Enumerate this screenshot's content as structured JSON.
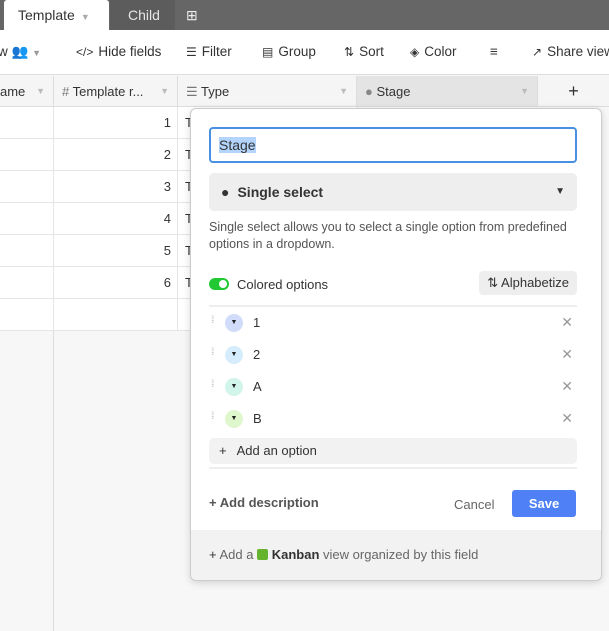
{
  "tabs": {
    "active": "Template",
    "child": "Child",
    "add_icon": "plus-square-icon"
  },
  "toolbar": {
    "view_partial": "w",
    "hide_fields": "Hide fields",
    "filter": "Filter",
    "group": "Group",
    "sort": "Sort",
    "color": "Color",
    "share": "Share view"
  },
  "columns": [
    "ame",
    "Template r...",
    "Type",
    "Stage"
  ],
  "rows": [
    {
      "num": "1",
      "type": "T"
    },
    {
      "num": "2",
      "type": "T"
    },
    {
      "num": "3",
      "type": "T"
    },
    {
      "num": "4",
      "type": "T"
    },
    {
      "num": "5",
      "type": "T"
    },
    {
      "num": "6",
      "type": "T"
    }
  ],
  "popup": {
    "field_name": "Stage",
    "field_type": "Single select",
    "description": "Single select allows you to select a single option from predefined options in a dropdown.",
    "colored_options_label": "Colored options",
    "colored_options_on": true,
    "alphabetize": "Alphabetize",
    "options": [
      {
        "label": "1",
        "color": "#d0dcfa"
      },
      {
        "label": "2",
        "color": "#d4ecfc"
      },
      {
        "label": "A",
        "color": "#d1f5ea"
      },
      {
        "label": "B",
        "color": "#dff7cd"
      }
    ],
    "add_option": "Add an option",
    "add_description": "Add description",
    "cancel": "Cancel",
    "save": "Save",
    "footer_prefix": "Add a",
    "footer_kanban": "Kanban",
    "footer_suffix": "view organized by this field"
  },
  "colors": {
    "accent": "#5080f5",
    "toggle": "#20c933",
    "kanban": "#66b32e"
  }
}
